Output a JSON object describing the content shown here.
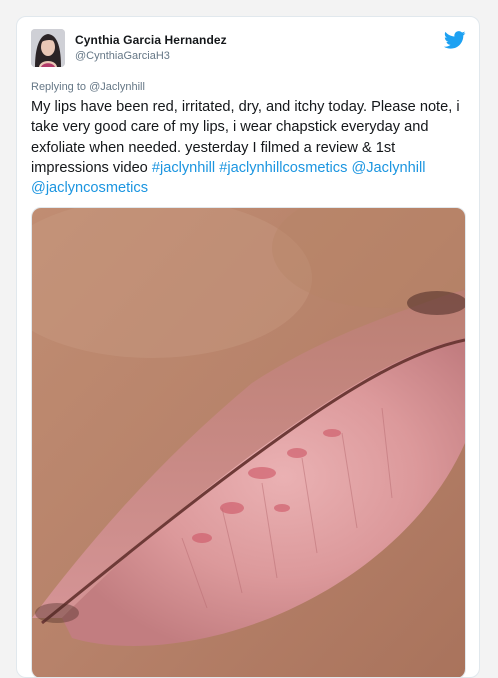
{
  "tweet": {
    "author_name": "Cynthia Garcia Hernandez",
    "author_handle": "@CynthiaGarciaH3",
    "replying_label": "Replying to",
    "replying_handle": "@Jaclynhill",
    "text_plain": "My lips have been red, irritated, dry, and itchy today. Please note, i take very good care of my lips, i wear chapstick everyday and exfoliate when needed. yesterday I filmed a review & 1st impressions video",
    "hashtag_1": "#jaclynhill",
    "hashtag_2": "#jaclynhillcosmetics",
    "mention_1": "@Jaclynhill",
    "mention_2": "@jaclyncosmetics"
  },
  "icons": {
    "avatar": "user-avatar",
    "brand": "twitter-bird-icon"
  },
  "colors": {
    "accent": "#1da1f2",
    "link": "#1b95e0",
    "text": "#14171a",
    "muted": "#657786",
    "border": "#e1e8ed"
  }
}
